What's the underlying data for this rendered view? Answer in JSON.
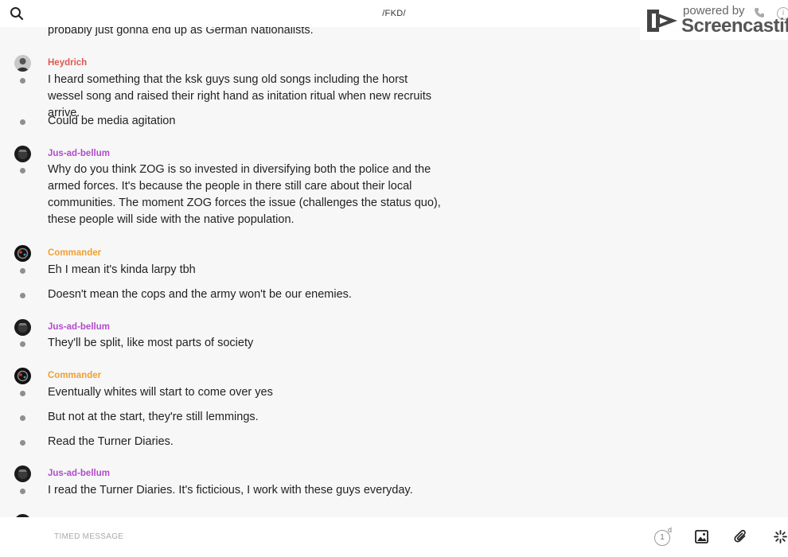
{
  "header": {
    "channel": "/FKD/"
  },
  "watermark": {
    "powered_by": "powered by",
    "brand": "Screencastify"
  },
  "messages": {
    "partial_text": "probably just gonna end up as German Nationalists.",
    "groups": [
      {
        "author": "Heydrich",
        "texts": [
          "I heard something that the ksk guys sung old songs including the horst wessel song and raised their right hand as initation ritual when new recruits arrive.",
          "Could be media agitation"
        ]
      },
      {
        "author": "Jus-ad-bellum",
        "texts": [
          "Why do you think ZOG is so invested in diversifying both the police and the armed forces. It's because the people in there still care about their local communities. The moment ZOG forces the issue (challenges the status quo), these people will side with the native population."
        ]
      },
      {
        "author": "Commander",
        "texts": [
          "Eh I mean it's kinda larpy tbh",
          "Doesn't mean the cops and the army won't be our enemies."
        ]
      },
      {
        "author": "Jus-ad-bellum",
        "texts": [
          "They'll be split, like most parts of society"
        ]
      },
      {
        "author": "Commander",
        "texts": [
          "Eventually whites will start to come over yes",
          "But not at the start, they're still lemmings.",
          "Read the Turner Diaries."
        ]
      },
      {
        "author": "Jus-ad-bellum",
        "texts": [
          "I read the Turner Diaries. It's ficticious, I work with these guys everyday."
        ]
      }
    ]
  },
  "composer": {
    "placeholder": "TIMED MESSAGE",
    "timer_value": "1",
    "timer_unit": "d"
  },
  "colors": {
    "heydrich": "#e0584f",
    "jus_ad_bellum": "#b24ccc",
    "commander": "#f19f30",
    "background": "#f7f7f7"
  }
}
